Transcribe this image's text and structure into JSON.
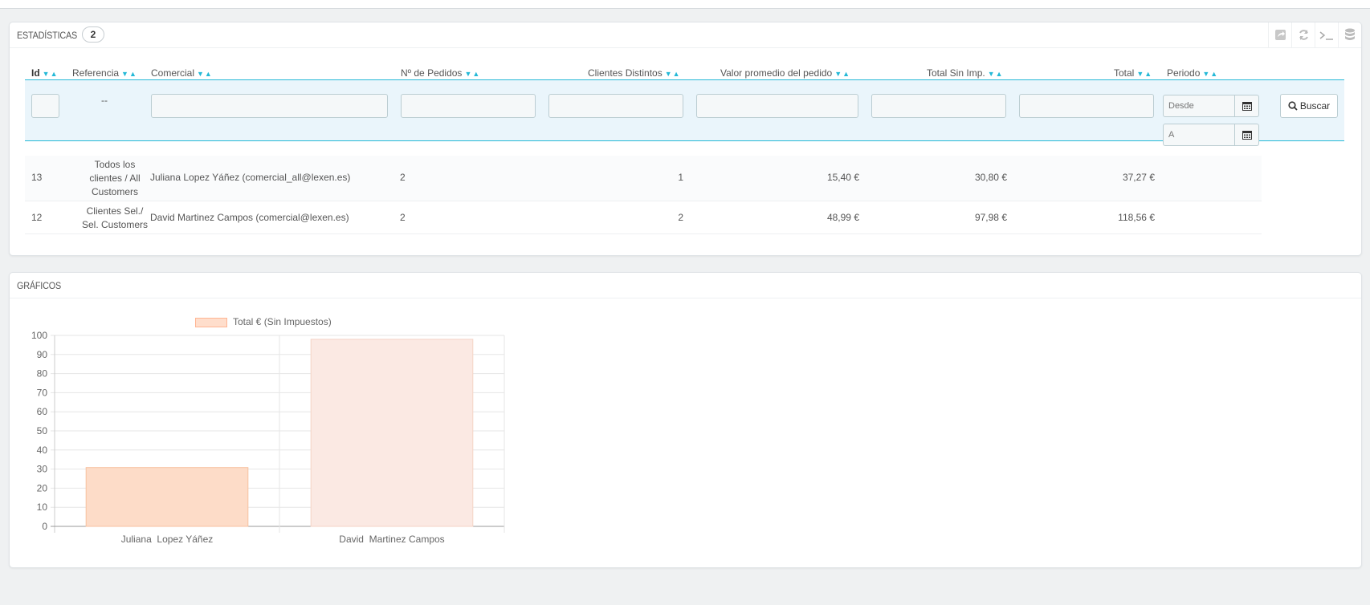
{
  "stats_panel": {
    "title": "ESTADÍSTICAS",
    "count": "2",
    "tools": [
      "export-icon",
      "refresh-icon",
      "sql-query-icon",
      "database-icon"
    ],
    "columns": {
      "id": "Id",
      "referencia": "Referencia",
      "comercial": "Comercial",
      "pedidos": "Nº de Pedidos",
      "clientes": "Clientes Distintos",
      "valor": "Valor promedio del pedido",
      "total_sin": "Total Sin Imp.",
      "total": "Total",
      "periodo": "Periodo"
    },
    "filters": {
      "referencia_placeholder": "--",
      "desde_placeholder": "Desde",
      "a_placeholder": "A",
      "buscar_label": "Buscar"
    },
    "rows": [
      {
        "id": "13",
        "referencia": [
          "Todos los",
          "clientes / All",
          "Customers"
        ],
        "comercial": "Juliana Lopez Yáñez (comercial_all@lexen.es)",
        "pedidos": "2",
        "clientes": "1",
        "valor": "15,40 €",
        "total_sin": "30,80 €",
        "total": "37,27 €"
      },
      {
        "id": "12",
        "referencia": [
          "Clientes Sel./",
          "Sel. Customers"
        ],
        "comercial": "David Martinez Campos (comercial@lexen.es)",
        "pedidos": "2",
        "clientes": "2",
        "valor": "48,99 €",
        "total_sin": "97,98 €",
        "total": "118,56 €"
      }
    ]
  },
  "charts_panel": {
    "title": "GRÁFICOS"
  },
  "chart_data": {
    "type": "bar",
    "categories": [
      "Juliana  Lopez Yáñez",
      "David  Martinez Campos"
    ],
    "series": [
      {
        "name": "Total € (Sin Impuestos)",
        "values": [
          30.8,
          97.98
        ]
      }
    ],
    "y_ticks": [
      "100",
      "90",
      "80",
      "70",
      "60",
      "50",
      "40",
      "30",
      "20",
      "10",
      "0"
    ],
    "ylim": [
      0,
      100
    ],
    "legend_position": "top",
    "grid": true,
    "colors": {
      "bar1_fill": "#fddcc8",
      "bar1_stroke": "#f7c19f",
      "bar2_fill": "#fbe9e3",
      "bar2_stroke": "#f5d3c6"
    }
  }
}
